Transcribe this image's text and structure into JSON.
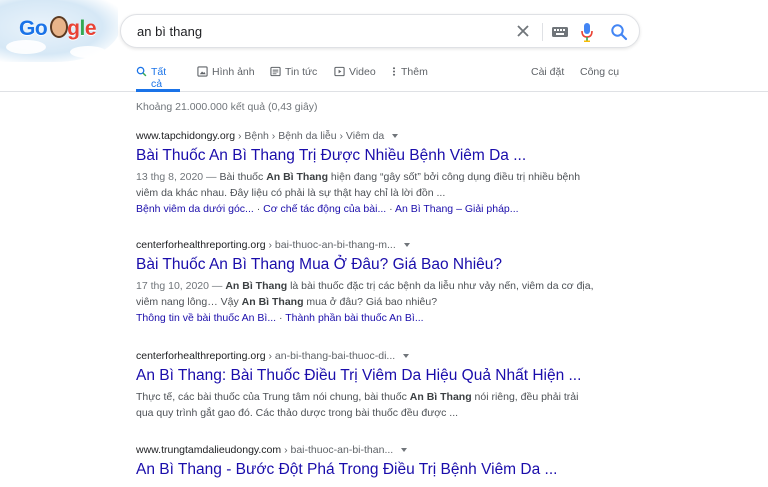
{
  "header": {
    "logo": {
      "g1": "Go",
      "face": "",
      "g2": "g",
      "l": "l",
      "e": "e"
    },
    "search": {
      "query": "an bì thang"
    }
  },
  "tabs": [
    {
      "label": "Tất cả",
      "icon": "search-icon"
    },
    {
      "label": "Hình ảnh",
      "icon": "image-icon"
    },
    {
      "label": "Tin tức",
      "icon": "news-icon"
    },
    {
      "label": "Video",
      "icon": "video-icon"
    },
    {
      "label": "Thêm",
      "icon": "more-icon"
    }
  ],
  "tabs_right": {
    "settings": "Cài đặt",
    "tools": "Công cụ"
  },
  "stats": "Khoảng 21.000.000 kết quả (0,43 giây)",
  "results": [
    {
      "site": "www.tapchidongy.org",
      "crumbs": "› Bệnh › Bệnh da liễu › Viêm da",
      "title": "Bài Thuốc An Bì Thang Trị Được Nhiều Bệnh Viêm Da ...",
      "date": "13 thg 8, 2020 —",
      "snippet_a": " Bài thuốc ",
      "snippet_b1": "An Bì Thang",
      "snippet_c": " hiện đang “gây sốt” bởi công dụng điều trị nhiều bệnh viêm da khác nhau. Đây liệu có phải là sự thật hay chỉ là lời đồn ...",
      "snippet_b2": "",
      "snippet_d": "",
      "sitelinks": [
        "Bệnh viêm da dưới góc...",
        "Cơ chế tác động của bài...",
        "An Bì Thang – Giải pháp..."
      ]
    },
    {
      "site": "centerforhealthreporting.org",
      "crumbs": "› bai-thuoc-an-bi-thang-m...",
      "title": "Bài Thuốc An Bì Thang Mua Ở Đâu? Giá Bao Nhiêu?",
      "date": "17 thg 10, 2020 —",
      "snippet_a": " ",
      "snippet_b1": "An Bì Thang",
      "snippet_c": " là bài thuốc đặc trị các bệnh da liễu như vảy nến, viêm da cơ địa, viêm nang lông… Vậy ",
      "snippet_b2": "An Bì Thang",
      "snippet_d": " mua ở đâu? Giá bao nhiêu?",
      "sitelinks": [
        "Thông tin về bài thuốc An Bì...",
        "Thành phần bài thuốc An Bì..."
      ]
    },
    {
      "site": "centerforhealthreporting.org",
      "crumbs": "› an-bi-thang-bai-thuoc-di...",
      "title": "An Bì Thang: Bài Thuốc Điều Trị Viêm Da Hiệu Quả Nhất Hiện ...",
      "date": "",
      "snippet_a": "Thực tế, các bài thuốc của Trung tâm nói chung, bài thuốc ",
      "snippet_b1": "An Bì Thang",
      "snippet_c": " nói riêng, đều phải trải qua quy trình gắt gao đó. Các thảo dược trong bài thuốc đều được ...",
      "snippet_b2": "",
      "snippet_d": "",
      "sitelinks": []
    },
    {
      "site": "www.trungtamdalieudongy.com",
      "crumbs": "› bai-thuoc-an-bi-than...",
      "title": "An Bì Thang - Bước Đột Phá Trong Điều Trị Bệnh Viêm Da ...",
      "date": "",
      "snippet_a": "",
      "snippet_b1": "",
      "snippet_c": "",
      "snippet_b2": "",
      "snippet_d": "",
      "sitelinks": []
    }
  ],
  "colors": {
    "link": "#1a0dab",
    "accent": "#1a73e8",
    "text": "#4d5156"
  }
}
